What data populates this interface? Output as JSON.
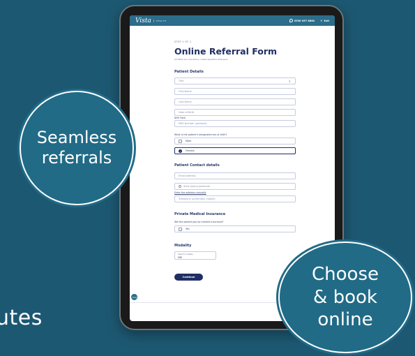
{
  "background": {
    "text": "utes",
    "color": "#1d5872"
  },
  "header": {
    "logo": "Vista",
    "logo_sub": "HEALTH",
    "phone": "0330 057 8864",
    "exit": "Exit"
  },
  "form": {
    "step": "STEP 1 OF 2",
    "title": "Online Referral Form",
    "note": "All fields are mandatory unless specified otherwise",
    "patient_details": {
      "heading": "Patient Details",
      "title_field": "Title",
      "first_name": "First Name",
      "last_name": "Last Name",
      "dob": "Date of Birth",
      "nhs_label": "NHS Field",
      "nhs_placeholder": "NHS Number (optional)",
      "sex_question": "What is the patient's designated sex at birth?",
      "sex_options": [
        "Male",
        "Female"
      ],
      "sex_selected": "Female"
    },
    "contact": {
      "heading": "Patient Contact details",
      "email": "Email address",
      "postcode": "Start typing postcode",
      "manual_label": "Enter the address manually",
      "phone": "Telephone (preferably mobile)"
    },
    "insurance": {
      "heading": "Private Medical Insurance",
      "question": "Will the patient pay by medical insurance?",
      "option": "Yes"
    },
    "modality": {
      "heading": "Modality",
      "select_label": "Select modality",
      "select_value": "MRI"
    },
    "continue_label": "Continue"
  },
  "chat_icon_label": "Chat",
  "bubbles": {
    "left": [
      "Seamless",
      "referrals"
    ],
    "right": [
      "Choose",
      "& book",
      "online"
    ]
  },
  "colors": {
    "brand": "#2b6d8a",
    "navy": "#1f2f63",
    "bubble": "#216b87"
  }
}
